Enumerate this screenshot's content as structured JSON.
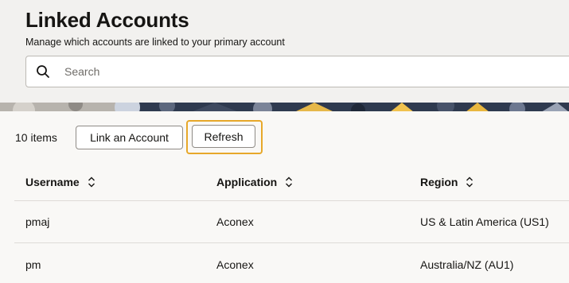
{
  "header": {
    "title": "Linked Accounts",
    "subtitle": "Manage which accounts are linked to your primary account",
    "search": {
      "placeholder": "Search",
      "value": "",
      "icon": "search-icon"
    }
  },
  "toolbar": {
    "count_label": "10 items",
    "link_account_label": "Link an Account",
    "refresh_label": "Refresh",
    "focus_color": "#e7a82a"
  },
  "table": {
    "columns": [
      {
        "label": "Username",
        "sort_icon": "sort-icon"
      },
      {
        "label": "Application",
        "sort_icon": "sort-icon"
      },
      {
        "label": "Region",
        "sort_icon": "sort-icon"
      }
    ],
    "rows": [
      {
        "username": "pmaj",
        "application": "Aconex",
        "region": "US & Latin America (US1)"
      },
      {
        "username": "pm",
        "application": "Aconex",
        "region": "Australia/NZ (AU1)"
      }
    ]
  }
}
